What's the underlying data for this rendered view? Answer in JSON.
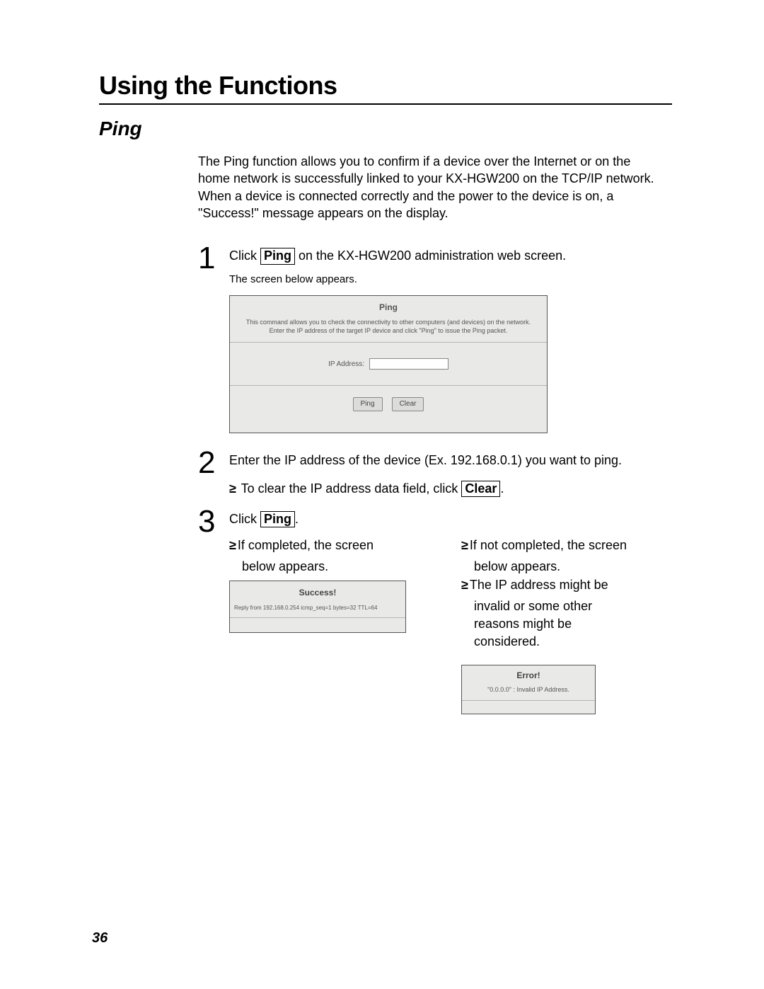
{
  "section_title": "Using the Functions",
  "subtitle": "Ping",
  "intro": "The Ping function allows you to confirm if a device over the Internet or on the home network is successfully linked to your KX-HGW200 on the TCP/IP network. When a device is connected correctly and the power to the device is on, a \"Success!\" message appears on the display.",
  "step1": {
    "num": "1",
    "text_before": "Click ",
    "btn": "Ping",
    "text_after": " on the KX-HGW200 administration web screen.",
    "note": "The screen below appears."
  },
  "ping_shot": {
    "title": "Ping",
    "desc_line1": "This command allows you to check the connectivity to other computers (and devices) on the network.",
    "desc_line2": "Enter the IP address of the target IP device and click \"Ping\" to issue the Ping packet.",
    "ip_label": "IP Address:",
    "btn_ping": "Ping",
    "btn_clear": "Clear"
  },
  "step2": {
    "num": "2",
    "text": "Enter the IP address of the device (Ex. 192.168.0.1) you want to ping.",
    "bullet_before": "To clear the IP address data field, click ",
    "bullet_btn": "Clear",
    "bullet_after": "."
  },
  "step3": {
    "num": "3",
    "text_before": "Click ",
    "btn": "Ping",
    "text_after": ".",
    "left_bullet_a": "If completed, the screen",
    "left_bullet_b": "below appears.",
    "right_bullet1_a": "If not completed, the screen",
    "right_bullet1_b": "below appears.",
    "right_bullet2_a": "The IP address might be",
    "right_bullet2_b": "invalid or some other",
    "right_bullet2_c": "reasons might be",
    "right_bullet2_d": "considered."
  },
  "success": {
    "title": "Success!",
    "msg": "Reply from 192.168.0.254 icmp_seq=1 bytes=32 TTL=64"
  },
  "error": {
    "title": "Error!",
    "msg": "\"0.0.0.0\" : Invalid IP Address."
  },
  "page_number": "36"
}
